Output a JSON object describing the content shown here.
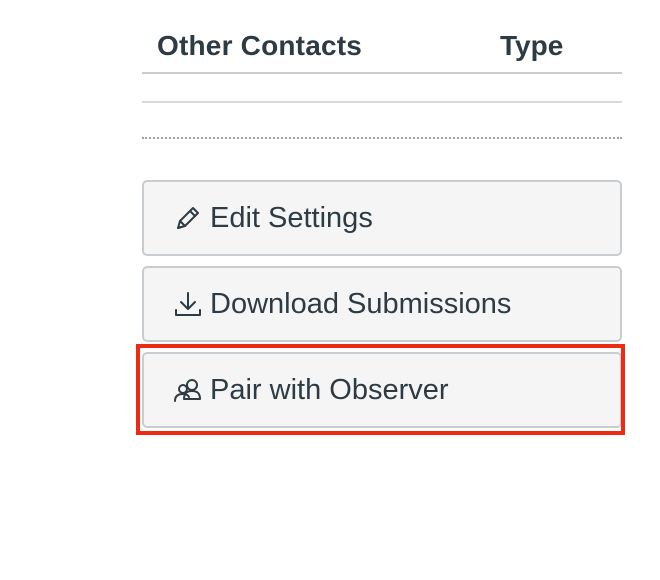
{
  "table": {
    "headers": {
      "contacts": "Other Contacts",
      "type": "Type"
    }
  },
  "actions": {
    "edit_settings": {
      "label": "Edit Settings",
      "icon": "pencil-icon"
    },
    "download_submissions": {
      "label": "Download Submissions",
      "icon": "download-icon"
    },
    "pair_with_observer": {
      "label": "Pair with Observer",
      "icon": "users-icon"
    }
  },
  "colors": {
    "text": "#2d3b45",
    "button_bg": "#f5f5f5",
    "button_border": "#c7cdd1",
    "highlight": "#ee2a12"
  }
}
